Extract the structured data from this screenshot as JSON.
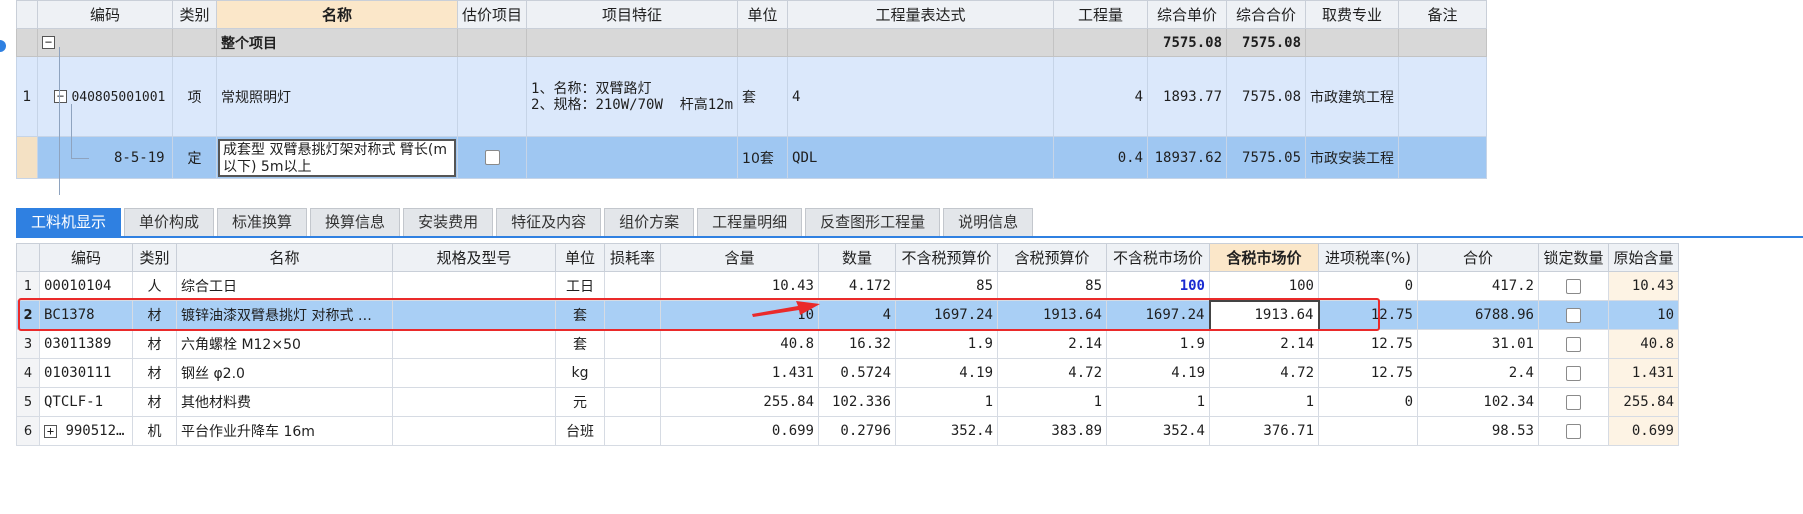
{
  "colors": {
    "accent": "#2f80e1",
    "selected_row": "#a9cff5",
    "quota_row": "#9fc7f2",
    "item_row": "#dbe8fb",
    "group_row": "#d8d8d8",
    "annotation_red": "#ea2a2a",
    "highlight_header": "#fbe7c9",
    "market_price_emphasis": "#1a2bd1"
  },
  "top_grid": {
    "headers": [
      "编码",
      "类别",
      "名称",
      "估价项目",
      "项目特征",
      "单位",
      "工程量表达式",
      "工程量",
      "综合单价",
      "综合合价",
      "取费专业",
      "备注"
    ],
    "group_row": {
      "toggle": "−",
      "name": "整个项目",
      "unit_price": "7575.08",
      "total": "7575.08"
    },
    "item_row": {
      "index": "1",
      "toggle": "−",
      "code": "040805001001",
      "type": "项",
      "name": "常规照明灯",
      "features": "1、名称：双臂路灯\n2、规格：210W/70W  杆高12m",
      "unit": "套",
      "expression": "4",
      "quantity": "4",
      "unit_price": "1893.77",
      "total": "7575.08",
      "fee_category": "市政建筑工程"
    },
    "quota_row": {
      "code": "8-5-19",
      "type": "定",
      "name": "成套型 双臂悬挑灯架对称式 臂长(m以下) 5m以上",
      "unit": "10套",
      "expression": "QDL",
      "quantity": "0.4",
      "unit_price": "18937.62",
      "total": "7575.05",
      "fee_category": "市政安装工程"
    }
  },
  "tabs": [
    "工料机显示",
    "单价构成",
    "标准换算",
    "换算信息",
    "安装费用",
    "特征及内容",
    "组价方案",
    "工程量明细",
    "反查图形工程量",
    "说明信息"
  ],
  "bottom_grid": {
    "headers": [
      "编码",
      "类别",
      "名称",
      "规格及型号",
      "单位",
      "损耗率",
      "含量",
      "数量",
      "不含税预算价",
      "含税预算价",
      "不含税市场价",
      "含税市场价",
      "进项税率(%)",
      "合价",
      "锁定数量",
      "原始含量"
    ],
    "rows": [
      {
        "idx": "1",
        "code": "00010104",
        "type": "人",
        "name": "综合工日",
        "spec": "",
        "unit": "工日",
        "loss": "",
        "content": "10.43",
        "qty": "4.172",
        "pre_notax": "85",
        "pre_tax": "85",
        "mkt_notax": "100",
        "mkt_tax": "100",
        "tax_rate": "0",
        "total": "417.2",
        "orig": "10.43"
      },
      {
        "idx": "2",
        "code": "BC1378",
        "type": "材",
        "name": "镀锌油漆双臂悬挑灯 对称式 …",
        "spec": "",
        "unit": "套",
        "loss": "",
        "content": "10",
        "qty": "4",
        "pre_notax": "1697.24",
        "pre_tax": "1913.64",
        "mkt_notax": "1697.24",
        "mkt_tax": "1913.64",
        "tax_rate": "12.75",
        "total": "6788.96",
        "orig": "10"
      },
      {
        "idx": "3",
        "code": "03011389",
        "type": "材",
        "name": "六角螺栓 M12×50",
        "spec": "",
        "unit": "套",
        "loss": "",
        "content": "40.8",
        "qty": "16.32",
        "pre_notax": "1.9",
        "pre_tax": "2.14",
        "mkt_notax": "1.9",
        "mkt_tax": "2.14",
        "tax_rate": "12.75",
        "total": "31.01",
        "orig": "40.8"
      },
      {
        "idx": "4",
        "code": "01030111",
        "type": "材",
        "name": "钢丝 φ2.0",
        "spec": "",
        "unit": "kg",
        "loss": "",
        "content": "1.431",
        "qty": "0.5724",
        "pre_notax": "4.19",
        "pre_tax": "4.72",
        "mkt_notax": "4.19",
        "mkt_tax": "4.72",
        "tax_rate": "12.75",
        "total": "2.4",
        "orig": "1.431"
      },
      {
        "idx": "5",
        "code": "QTCLF-1",
        "type": "材",
        "name": "其他材料费",
        "spec": "",
        "unit": "元",
        "loss": "",
        "content": "255.84",
        "qty": "102.336",
        "pre_notax": "1",
        "pre_tax": "1",
        "mkt_notax": "1",
        "mkt_tax": "1",
        "tax_rate": "0",
        "total": "102.34",
        "orig": "255.84"
      },
      {
        "idx": "6",
        "code": "990512…",
        "type": "机",
        "name": "平台作业升降车 16m",
        "spec": "",
        "unit": "台班",
        "loss": "",
        "content": "0.699",
        "qty": "0.2796",
        "pre_notax": "352.4",
        "pre_tax": "383.89",
        "mkt_notax": "352.4",
        "mkt_tax": "376.71",
        "tax_rate": "",
        "total": "98.53",
        "orig": "0.699"
      }
    ],
    "expand_toggle": "+"
  }
}
